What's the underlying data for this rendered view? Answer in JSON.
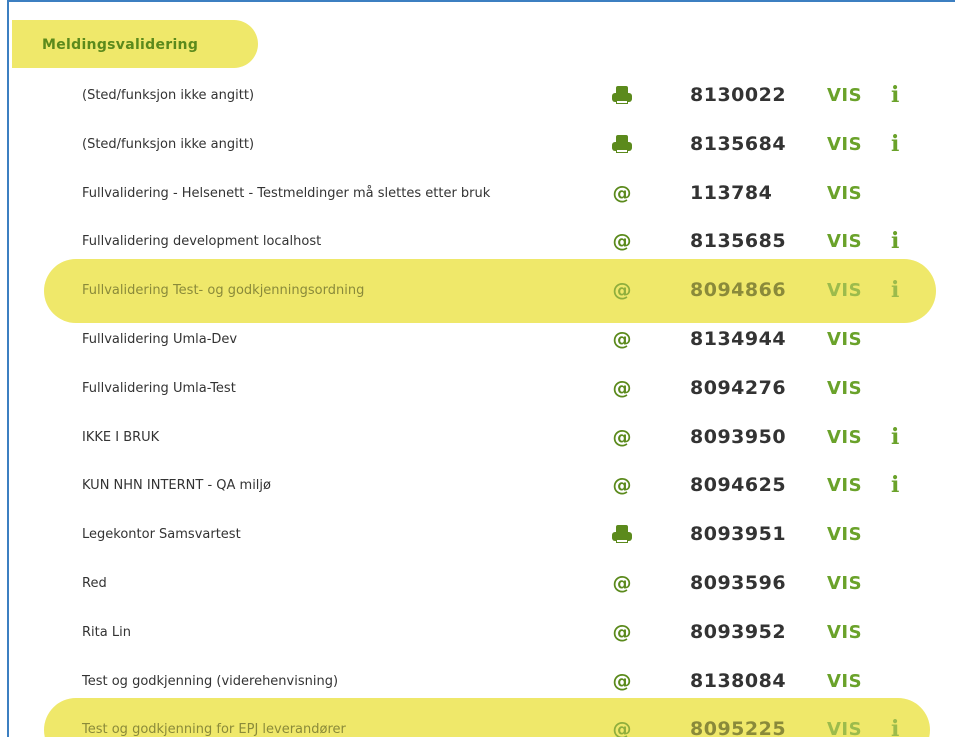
{
  "section": {
    "title": "Meldingsvalidering"
  },
  "rows": [
    {
      "name": "(Sted/funksjon ikke angitt)",
      "type_icon": "printer-icon",
      "code": "8130022",
      "vis": "VIS",
      "info": "i",
      "has_info": true,
      "highlighted": false
    },
    {
      "name": "(Sted/funksjon ikke angitt)",
      "type_icon": "printer-icon",
      "code": "8135684",
      "vis": "VIS",
      "info": "i",
      "has_info": true,
      "highlighted": false
    },
    {
      "name": "Fullvalidering - Helsenett - Testmeldinger må slettes etter bruk",
      "type_icon": "at-icon",
      "code": "113784",
      "vis": "VIS",
      "info": "",
      "has_info": false,
      "highlighted": false
    },
    {
      "name": "Fullvalidering development localhost",
      "type_icon": "at-icon",
      "code": "8135685",
      "vis": "VIS",
      "info": "i",
      "has_info": true,
      "highlighted": false
    },
    {
      "name": "Fullvalidering Test- og godkjenningsordning",
      "type_icon": "at-icon",
      "code": "8094866",
      "vis": "VIS",
      "info": "i",
      "has_info": true,
      "highlighted": true
    },
    {
      "name": "Fullvalidering Umla-Dev",
      "type_icon": "at-icon",
      "code": "8134944",
      "vis": "VIS",
      "info": "",
      "has_info": false,
      "highlighted": false
    },
    {
      "name": "Fullvalidering Umla-Test",
      "type_icon": "at-icon",
      "code": "8094276",
      "vis": "VIS",
      "info": "",
      "has_info": false,
      "highlighted": false
    },
    {
      "name": "IKKE I BRUK",
      "type_icon": "at-icon",
      "code": "8093950",
      "vis": "VIS",
      "info": "i",
      "has_info": true,
      "highlighted": false
    },
    {
      "name": "KUN NHN INTERNT - QA miljø",
      "type_icon": "at-icon",
      "code": "8094625",
      "vis": "VIS",
      "info": "i",
      "has_info": true,
      "highlighted": false
    },
    {
      "name": "Legekontor Samsvartest",
      "type_icon": "printer-icon",
      "code": "8093951",
      "vis": "VIS",
      "info": "",
      "has_info": false,
      "highlighted": false
    },
    {
      "name": "Red",
      "type_icon": "at-icon",
      "code": "8093596",
      "vis": "VIS",
      "info": "",
      "has_info": false,
      "highlighted": false
    },
    {
      "name": "Rita Lin",
      "type_icon": "at-icon",
      "code": "8093952",
      "vis": "VIS",
      "info": "",
      "has_info": false,
      "highlighted": false
    },
    {
      "name": "Test og godkjenning (viderehenvisning)",
      "type_icon": "at-icon",
      "code": "8138084",
      "vis": "VIS",
      "info": "",
      "has_info": false,
      "highlighted": false
    },
    {
      "name": "Test og godkjenning for EPJ leverandører",
      "type_icon": "at-icon",
      "code": "8095225",
      "vis": "VIS",
      "info": "i",
      "has_info": true,
      "highlighted": true
    }
  ],
  "icons": {
    "at_glyph": "@"
  },
  "colors": {
    "highlight": "#efe86a",
    "accent_green": "#6aa22a",
    "icon_green": "#5b8a1c",
    "border_blue": "#3c7fc1"
  }
}
